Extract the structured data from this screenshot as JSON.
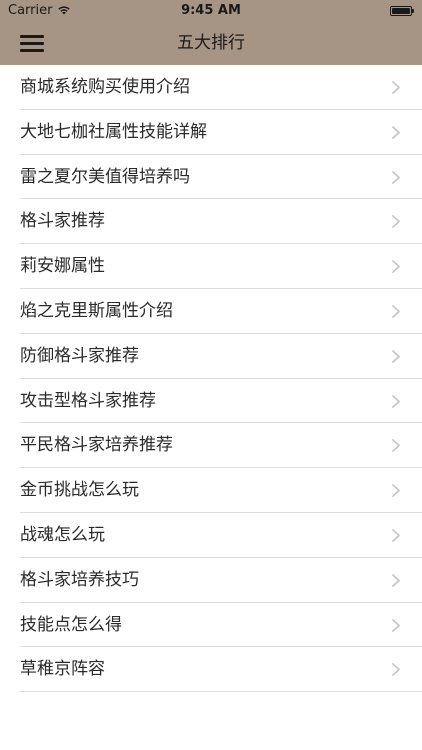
{
  "status_bar": {
    "carrier": "Carrier",
    "time": "9:45 AM"
  },
  "nav": {
    "title": "五大排行",
    "icon": "hamburger-menu-icon",
    "background": "#a69584"
  },
  "list": {
    "items": [
      {
        "label": "商城系统购买使用介绍"
      },
      {
        "label": "大地七枷社属性技能详解"
      },
      {
        "label": "雷之夏尔美值得培养吗"
      },
      {
        "label": "格斗家推荐"
      },
      {
        "label": "莉安娜属性"
      },
      {
        "label": "焰之克里斯属性介绍"
      },
      {
        "label": "防御格斗家推荐"
      },
      {
        "label": "攻击型格斗家推荐"
      },
      {
        "label": "平民格斗家培养推荐"
      },
      {
        "label": "金币挑战怎么玩"
      },
      {
        "label": "战魂怎么玩"
      },
      {
        "label": "格斗家培养技巧"
      },
      {
        "label": "技能点怎么得"
      },
      {
        "label": "草稚京阵容"
      }
    ]
  }
}
